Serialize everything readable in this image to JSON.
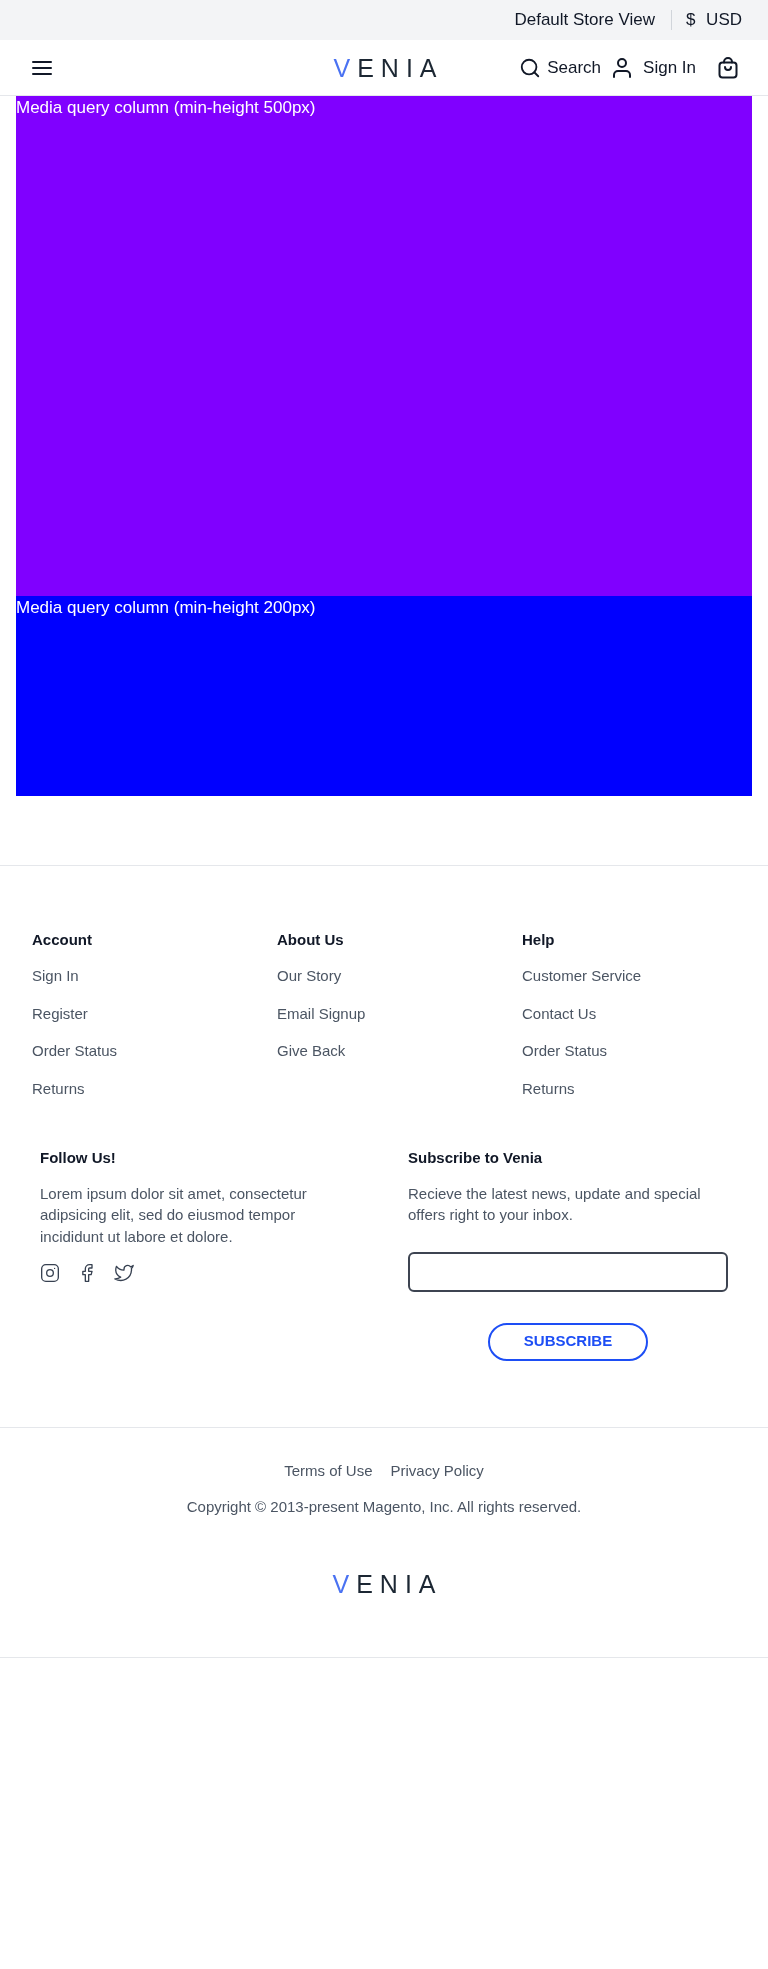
{
  "top_bar": {
    "store_view": "Default Store View",
    "currency_symbol": "$",
    "currency": "USD"
  },
  "header": {
    "logo": "VENIA",
    "search": "Search",
    "sign_in": "Sign In"
  },
  "content": {
    "columns": [
      {
        "kind": "tall",
        "text": "Media query column (min-height 500px)",
        "color": "#8000ff"
      },
      {
        "kind": "short",
        "text": "Media query column (min-height 200px)",
        "color": "#0000ff"
      }
    ]
  },
  "footer": {
    "link_columns": [
      {
        "heading": "Account",
        "links": [
          "Sign In",
          "Register",
          "Order Status",
          "Returns"
        ]
      },
      {
        "heading": "About Us",
        "links": [
          "Our Story",
          "Email Signup",
          "Give Back"
        ]
      },
      {
        "heading": "Help",
        "links": [
          "Customer Service",
          "Contact Us",
          "Order Status",
          "Returns"
        ]
      }
    ],
    "follow": {
      "heading": "Follow Us!",
      "text": "Lorem ipsum dolor sit amet, consectetur adipsicing elit, sed do eiusmod tempor incididunt ut labore et dolore."
    },
    "subscribe": {
      "heading": "Subscribe to Venia",
      "text": "Recieve the latest news, update and special offers right to your inbox.",
      "button": "SUBSCRIBE"
    },
    "legal_links": [
      "Terms of Use",
      "Privacy Policy"
    ],
    "copyright": "Copyright © 2013-present Magento, Inc. All rights reserved.",
    "logo": "VENIA"
  }
}
